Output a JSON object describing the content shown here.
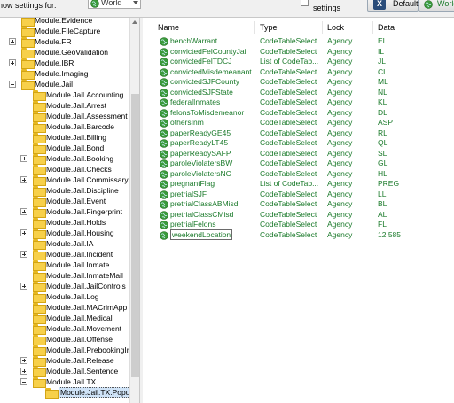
{
  "toolbar": {
    "show_label": "how settings for:",
    "scope_value": "World",
    "settings_label": "settings",
    "default_label": "Default",
    "world_label": "World"
  },
  "tree": {
    "items": [
      {
        "label": "Module.Evidence",
        "level": 1,
        "expander": "none"
      },
      {
        "label": "Module.FileCapture",
        "level": 1,
        "expander": "none"
      },
      {
        "label": "Module.FR",
        "level": 1,
        "expander": "plus"
      },
      {
        "label": "Module.GeoValidation",
        "level": 1,
        "expander": "none"
      },
      {
        "label": "Module.IBR",
        "level": 1,
        "expander": "plus"
      },
      {
        "label": "Module.Imaging",
        "level": 1,
        "expander": "none"
      },
      {
        "label": "Module.Jail",
        "level": 1,
        "expander": "minus"
      },
      {
        "label": "Module.Jail.Accounting",
        "level": 2,
        "expander": "none"
      },
      {
        "label": "Module.Jail.Arrest",
        "level": 2,
        "expander": "none"
      },
      {
        "label": "Module.Jail.Assessment",
        "level": 2,
        "expander": "none"
      },
      {
        "label": "Module.Jail.Barcode",
        "level": 2,
        "expander": "none"
      },
      {
        "label": "Module.Jail.Billing",
        "level": 2,
        "expander": "none"
      },
      {
        "label": "Module.Jail.Bond",
        "level": 2,
        "expander": "none"
      },
      {
        "label": "Module.Jail.Booking",
        "level": 2,
        "expander": "plus"
      },
      {
        "label": "Module.Jail.Checks",
        "level": 2,
        "expander": "none"
      },
      {
        "label": "Module.Jail.Commissary",
        "level": 2,
        "expander": "plus"
      },
      {
        "label": "Module.Jail.Discipline",
        "level": 2,
        "expander": "none"
      },
      {
        "label": "Module.Jail.Event",
        "level": 2,
        "expander": "none"
      },
      {
        "label": "Module.Jail.Fingerprint",
        "level": 2,
        "expander": "plus"
      },
      {
        "label": "Module.Jail.Holds",
        "level": 2,
        "expander": "none"
      },
      {
        "label": "Module.Jail.Housing",
        "level": 2,
        "expander": "plus"
      },
      {
        "label": "Module.Jail.IA",
        "level": 2,
        "expander": "none"
      },
      {
        "label": "Module.Jail.Incident",
        "level": 2,
        "expander": "plus"
      },
      {
        "label": "Module.Jail.Inmate",
        "level": 2,
        "expander": "none"
      },
      {
        "label": "Module.Jail.InmateMail",
        "level": 2,
        "expander": "none"
      },
      {
        "label": "Module.Jail.JailControls",
        "level": 2,
        "expander": "plus"
      },
      {
        "label": "Module.Jail.Log",
        "level": 2,
        "expander": "none"
      },
      {
        "label": "Module.Jail.MACrimApp",
        "level": 2,
        "expander": "none"
      },
      {
        "label": "Module.Jail.Medical",
        "level": 2,
        "expander": "none"
      },
      {
        "label": "Module.Jail.Movement",
        "level": 2,
        "expander": "none"
      },
      {
        "label": "Module.Jail.Offense",
        "level": 2,
        "expander": "none"
      },
      {
        "label": "Module.Jail.PrebookingInt",
        "level": 2,
        "expander": "none"
      },
      {
        "label": "Module.Jail.Release",
        "level": 2,
        "expander": "plus"
      },
      {
        "label": "Module.Jail.Sentence",
        "level": 2,
        "expander": "plus"
      },
      {
        "label": "Module.Jail.TX",
        "level": 2,
        "expander": "minus"
      },
      {
        "label": "Module.Jail.TX.Popula",
        "level": 3,
        "expander": "none",
        "selected": true
      }
    ]
  },
  "grid": {
    "headers": {
      "name": "Name",
      "type": "Type",
      "lock": "Lock",
      "data": "Data"
    },
    "rows": [
      {
        "name": "benchWarrant",
        "type": "CodeTableSelect",
        "lock": "Agency",
        "data": "EL"
      },
      {
        "name": "convictedFelCountyJail",
        "type": "CodeTableSelect",
        "lock": "Agency",
        "data": "IL"
      },
      {
        "name": "convictedFelTDCJ",
        "type": "List of CodeTab...",
        "lock": "Agency",
        "data": "JL"
      },
      {
        "name": "convictedMisdemeanant",
        "type": "CodeTableSelect",
        "lock": "Agency",
        "data": "CL"
      },
      {
        "name": "convictedSJFCounty",
        "type": "CodeTableSelect",
        "lock": "Agency",
        "data": "ML"
      },
      {
        "name": "convictedSJFState",
        "type": "CodeTableSelect",
        "lock": "Agency",
        "data": "NL"
      },
      {
        "name": "federalInmates",
        "type": "CodeTableSelect",
        "lock": "Agency",
        "data": "KL"
      },
      {
        "name": "felonsToMisdemeanor",
        "type": "CodeTableSelect",
        "lock": "Agency",
        "data": "DL"
      },
      {
        "name": "othersInm",
        "type": "CodeTableSelect",
        "lock": "Agency",
        "data": "ASP"
      },
      {
        "name": "paperReadyGE45",
        "type": "CodeTableSelect",
        "lock": "Agency",
        "data": "RL"
      },
      {
        "name": "paperReadyLT45",
        "type": "CodeTableSelect",
        "lock": "Agency",
        "data": "QL"
      },
      {
        "name": "paperReadySAFP",
        "type": "CodeTableSelect",
        "lock": "Agency",
        "data": "SL"
      },
      {
        "name": "paroleViolatersBW",
        "type": "CodeTableSelect",
        "lock": "Agency",
        "data": "GL"
      },
      {
        "name": "paroleViolatersNC",
        "type": "CodeTableSelect",
        "lock": "Agency",
        "data": "HL"
      },
      {
        "name": "pregnantFlag",
        "type": "List of CodeTab...",
        "lock": "Agency",
        "data": "PREG"
      },
      {
        "name": "pretrialSJF",
        "type": "CodeTableSelect",
        "lock": "Agency",
        "data": "LL"
      },
      {
        "name": "pretrialClassABMisd",
        "type": "CodeTableSelect",
        "lock": "Agency",
        "data": "BL"
      },
      {
        "name": "pretrialClassCMisd",
        "type": "CodeTableSelect",
        "lock": "Agency",
        "data": "AL"
      },
      {
        "name": "pretrialFelons",
        "type": "CodeTableSelect",
        "lock": "Agency",
        "data": "FL"
      },
      {
        "name": "weekendLocation",
        "type": "CodeTableSelect",
        "lock": "Agency",
        "data": "12   585",
        "editing": true
      }
    ]
  },
  "colors": {
    "value_text": "#1a7a2a",
    "folder": "#f7d04a",
    "selection": "#cfe3f7"
  }
}
